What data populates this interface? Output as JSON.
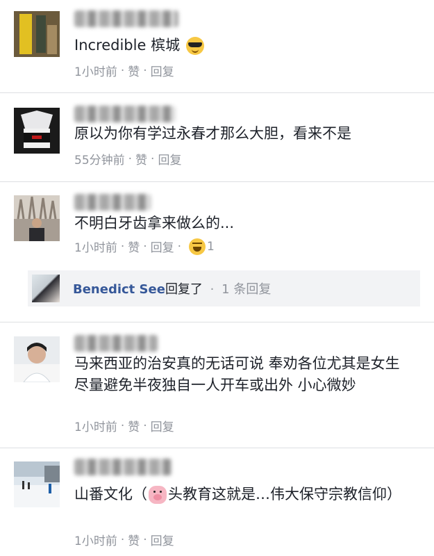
{
  "comments": [
    {
      "text": "Incredible 槟城",
      "time": "1小时前",
      "like": "赞",
      "reply": "回复",
      "emoji": "smiling-face-with-sunglasses"
    },
    {
      "text": "原以为你有学过永春才那么大胆，看来不是",
      "time": "55分钟前",
      "like": "赞",
      "reply": "回复"
    },
    {
      "text": "不明白牙齿拿来做么的...",
      "time": "1小时前",
      "like": "赞",
      "reply": "回复",
      "reaction_count": "1",
      "reaction": "laughing-face"
    },
    {
      "text": "马来西亚的治安真的无话可说 奉劝各位尤其是女生 尽量避免半夜独自一人开车或出外 小心微妙",
      "time": "1小时前",
      "like": "赞",
      "reply": "回复"
    },
    {
      "text_before": "山番文化（",
      "text_after": "头教育这就是…伟大保守宗教信仰）",
      "time": "1小时前",
      "like": "赞",
      "reply": "回复",
      "emoji": "pig-face"
    }
  ],
  "reply_thread": {
    "name": "Benedict See",
    "verb": "回复了",
    "count": "1 条回复"
  },
  "separator": "·",
  "colors": {
    "meta_text": "#90949c",
    "link_name": "#365899",
    "divider": "#dddfe2",
    "reply_bar_bg": "#f2f3f5"
  }
}
